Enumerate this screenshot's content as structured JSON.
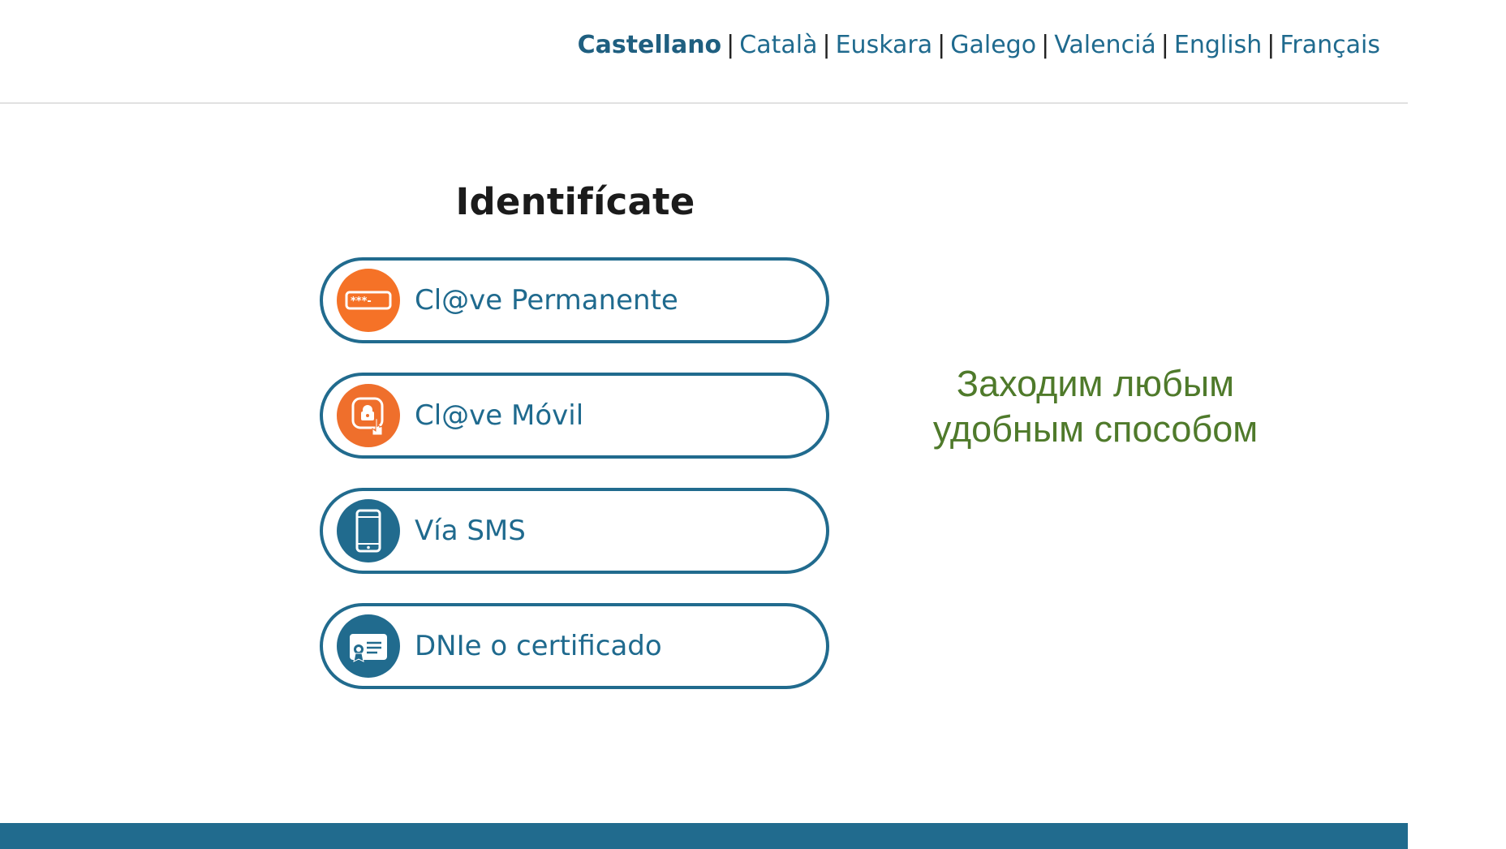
{
  "languages": [
    {
      "label": "Castellano",
      "active": true
    },
    {
      "label": "Català"
    },
    {
      "label": "Euskara"
    },
    {
      "label": "Galego"
    },
    {
      "label": "Valenciá"
    },
    {
      "label": "English"
    },
    {
      "label": "Français"
    }
  ],
  "separator": "|",
  "title": "Identifícate",
  "methods": [
    {
      "label": "Cl@ve Permanente",
      "icon": "password-field-icon",
      "color": "#f57227"
    },
    {
      "label": "Cl@ve Móvil",
      "icon": "mobile-app-touch-icon",
      "color": "#ef6f2c"
    },
    {
      "label": "Vía SMS",
      "icon": "smartphone-icon",
      "color": "#216b8e"
    },
    {
      "label": "DNIe o certificado",
      "icon": "certificate-icon",
      "color": "#216b8e"
    }
  ],
  "password_glyph": "***-",
  "promo_text": {
    "line1": "Заходим любым",
    "line2": "удобным способом"
  },
  "colors": {
    "primary": "#216b8e",
    "accent": "#f57227",
    "promo": "#4f7a2b"
  }
}
